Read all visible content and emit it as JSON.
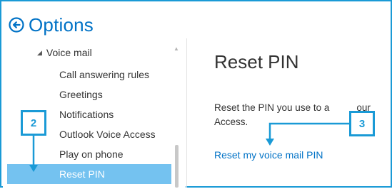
{
  "header": {
    "title": "Options",
    "back_icon": "back-arrow-circle-icon"
  },
  "sidebar": {
    "group_label": "Voice mail",
    "items": [
      {
        "label": "Call answering rules",
        "selected": false
      },
      {
        "label": "Greetings",
        "selected": false
      },
      {
        "label": "Notifications",
        "selected": false
      },
      {
        "label": "Outlook Voice Access",
        "selected": false
      },
      {
        "label": "Play on phone",
        "selected": false
      },
      {
        "label": "Reset PIN",
        "selected": true
      }
    ]
  },
  "main": {
    "title": "Reset PIN",
    "description": "Reset the PIN you use to a",
    "description_tail": "our",
    "description_line2": "Access.",
    "link_label": "Reset my voice mail PIN"
  },
  "callouts": [
    {
      "label": "2"
    },
    {
      "label": "3"
    }
  ],
  "colors": {
    "accent": "#0072c6",
    "callout": "#1a9ad6",
    "selected_bg": "#74c2f0"
  }
}
